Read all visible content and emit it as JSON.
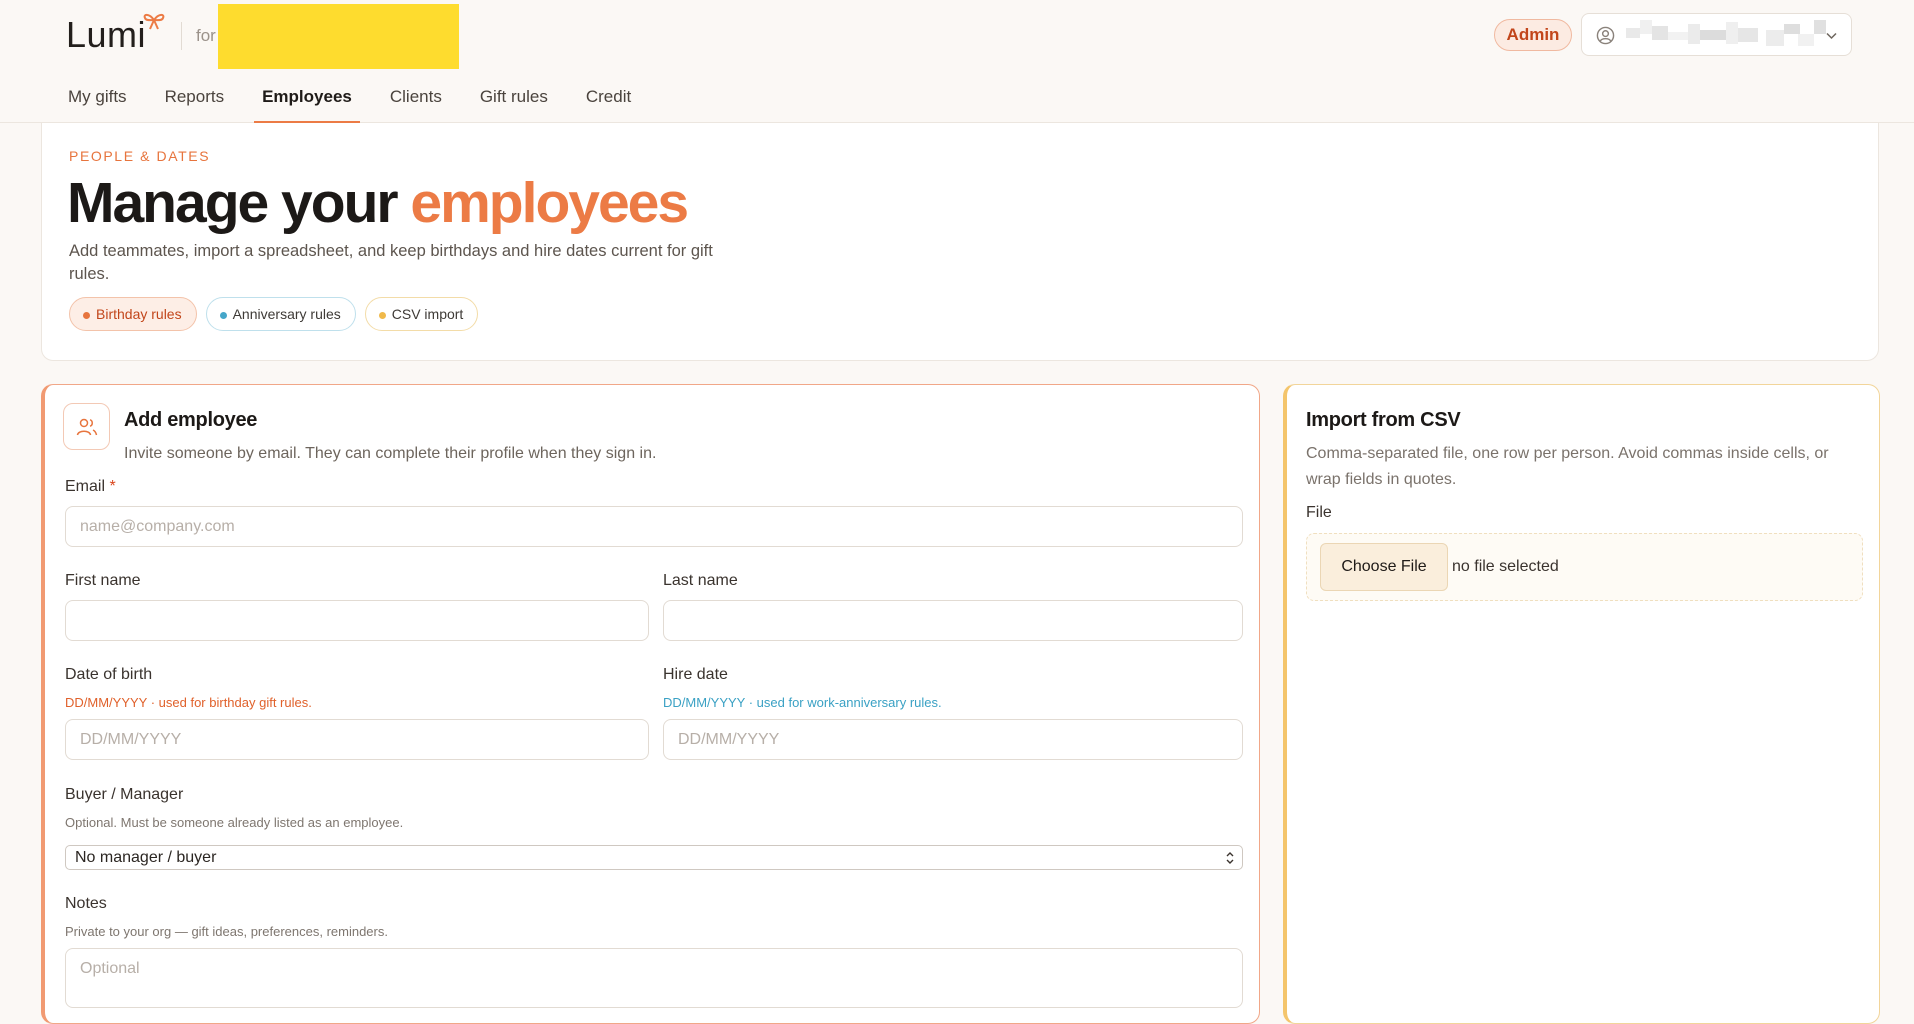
{
  "app": {
    "logo_text": "Lumi",
    "for_label": "for",
    "admin_badge": "Admin"
  },
  "nav": {
    "items": [
      {
        "label": "My gifts",
        "active": false
      },
      {
        "label": "Reports",
        "active": false
      },
      {
        "label": "Employees",
        "active": true
      },
      {
        "label": "Clients",
        "active": false
      },
      {
        "label": "Gift rules",
        "active": false
      },
      {
        "label": "Credit",
        "active": false
      }
    ]
  },
  "hero": {
    "eyebrow": "PEOPLE & DATES",
    "title_start": "Manage your ",
    "title_accent": "employees",
    "description": "Add teammates, import a spreadsheet, and keep birthdays and hire dates current for gift rules.",
    "pills": [
      "Birthday rules",
      "Anniversary rules",
      "CSV import"
    ]
  },
  "add_employee": {
    "title": "Add employee",
    "subtitle": "Invite someone by email. They can complete their profile when they sign in.",
    "email_label": "Email",
    "required_mark": "*",
    "email_placeholder": "name@company.com",
    "first_name_label": "First name",
    "last_name_label": "Last name",
    "dob_label": "Date of birth",
    "dob_hint": "DD/MM/YYYY · used for birthday gift rules.",
    "dob_placeholder": "DD/MM/YYYY",
    "hire_label": "Hire date",
    "hire_hint": "DD/MM/YYYY · used for work-anniversary rules.",
    "hire_placeholder": "DD/MM/YYYY",
    "manager_label": "Buyer / Manager",
    "manager_hint": "Optional. Must be someone already listed as an employee.",
    "manager_selected": "No manager / buyer",
    "notes_label": "Notes",
    "notes_hint": "Private to your org — gift ideas, preferences, reminders.",
    "notes_placeholder": "Optional"
  },
  "import_csv": {
    "title": "Import from CSV",
    "description": "Comma-separated file, one row per person. Avoid commas inside cells, or wrap fields in quotes.",
    "file_label": "File",
    "choose_button": "Choose File",
    "no_file_text": "no file selected"
  },
  "colors": {
    "accent": "#ec7b45",
    "anniversary": "#45a6c9",
    "csv": "#f0b94a",
    "org_redaction": "#fedc2e"
  }
}
